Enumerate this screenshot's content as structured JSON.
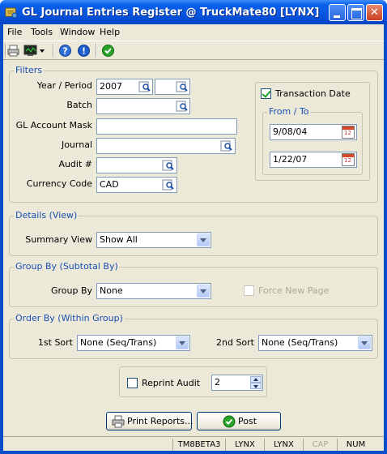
{
  "window": {
    "title": "GL Journal Entries Register @ TruckMate80 [LYNX]"
  },
  "menu": [
    "File",
    "Tools",
    "Window",
    "Help"
  ],
  "toolbar": {
    "icons": [
      "printer-icon",
      "monitor-icon",
      "dropdown-arrow-icon",
      "help-icon",
      "info-icon",
      "ok-check-icon"
    ]
  },
  "filters": {
    "legend": "Filters",
    "year_period_label": "Year / Period",
    "year_value": "2007",
    "period_value": "",
    "batch_label": "Batch",
    "batch_value": "",
    "gl_mask_label": "GL Account Mask",
    "gl_mask_value": "",
    "journal_label": "Journal",
    "journal_value": "",
    "audit_label": "Audit #",
    "audit_value": "",
    "currency_label": "Currency Code",
    "currency_value": "CAD",
    "transaction_date_label": "Transaction Date",
    "transaction_date_checked": true,
    "from_to_legend": "From / To",
    "from_date": "9/08/04",
    "to_date": "1/22/07"
  },
  "details": {
    "legend": "Details (View)",
    "summary_view_label": "Summary View",
    "summary_view_value": "Show All"
  },
  "group_by": {
    "legend": "Group By (Subtotal By)",
    "label": "Group By",
    "value": "None",
    "force_new_page_label": "Force New Page",
    "force_new_page_checked": false
  },
  "order_by": {
    "legend": "Order By (Within Group)",
    "first_label": "1st Sort",
    "first_value": "None (Seq/Trans)",
    "second_label": "2nd Sort",
    "second_value": "None (Seq/Trans)"
  },
  "reprint": {
    "label": "Reprint Audit",
    "checked": false,
    "value": "2"
  },
  "buttons": {
    "print_reports": "Print Reports...",
    "post": "Post"
  },
  "status": [
    "TM8BETA3",
    "LYNX",
    "LYNX",
    "CAP",
    "NUM"
  ],
  "colors": {
    "titlebar": "#0655df",
    "legend_text": "#1a4fb5",
    "face": "#ece9d8"
  }
}
